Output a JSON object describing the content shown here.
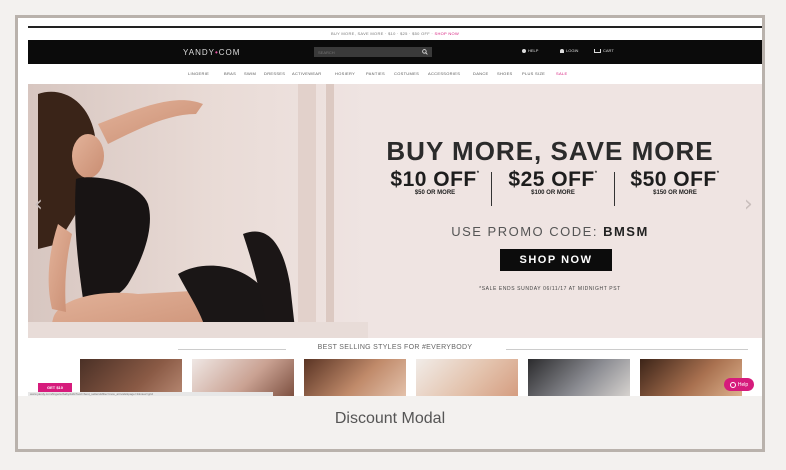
{
  "screenshot": {
    "promo_strip": {
      "text": "BUY MORE, SAVE MORE · $10 · $25 · $50 OFF · ",
      "highlight": "SHOP NOW"
    },
    "header": {
      "logo": "YANDY",
      "logo_dot": "•",
      "logo_suffix": "COM",
      "search_placeholder": "SEARCH",
      "help_label": "HELP",
      "login_label": "LOGIN",
      "cart_label": "CART"
    },
    "categories": [
      "LINGERIE",
      "BRAS",
      "SWIM",
      "DRESSES",
      "ACTIVEWEAR",
      "HOSIERY",
      "PANTIES",
      "COSTUMES",
      "ACCESSORIES",
      "DANCE",
      "SHOES",
      "PLUS SIZE",
      "SALE"
    ],
    "hero": {
      "title": "BUY MORE, SAVE MORE",
      "offers": [
        {
          "amount": "$10 OFF",
          "mark": "*",
          "sub": "$50 OR MORE"
        },
        {
          "amount": "$25 OFF",
          "mark": "*",
          "sub": "$100 OR MORE"
        },
        {
          "amount": "$50 OFF",
          "mark": "*",
          "sub": "$150 OR MORE"
        }
      ],
      "promo_label": "USE PROMO CODE: ",
      "promo_code": "BMSM",
      "cta": "SHOP NOW",
      "disclaimer": "*SALE ENDS SUNDAY 06/11/17 AT MIDNIGHT PST",
      "prev_arrow": "‹",
      "next_arrow": "›"
    },
    "section_title": "BEST SELLING STYLES FOR #EVERYBODY",
    "get_button": "GET $10",
    "status_url": "www.yandy.com/lingerie/babydolls?sort=best_sellers&filter=new_arrivals&page=1&view=grid",
    "help_button": "Help"
  },
  "caption": "Discount Modal",
  "colors": {
    "accent": "#d61b7c",
    "navbar": "#0b0b0b",
    "hero_bg": "#efe4e2"
  }
}
